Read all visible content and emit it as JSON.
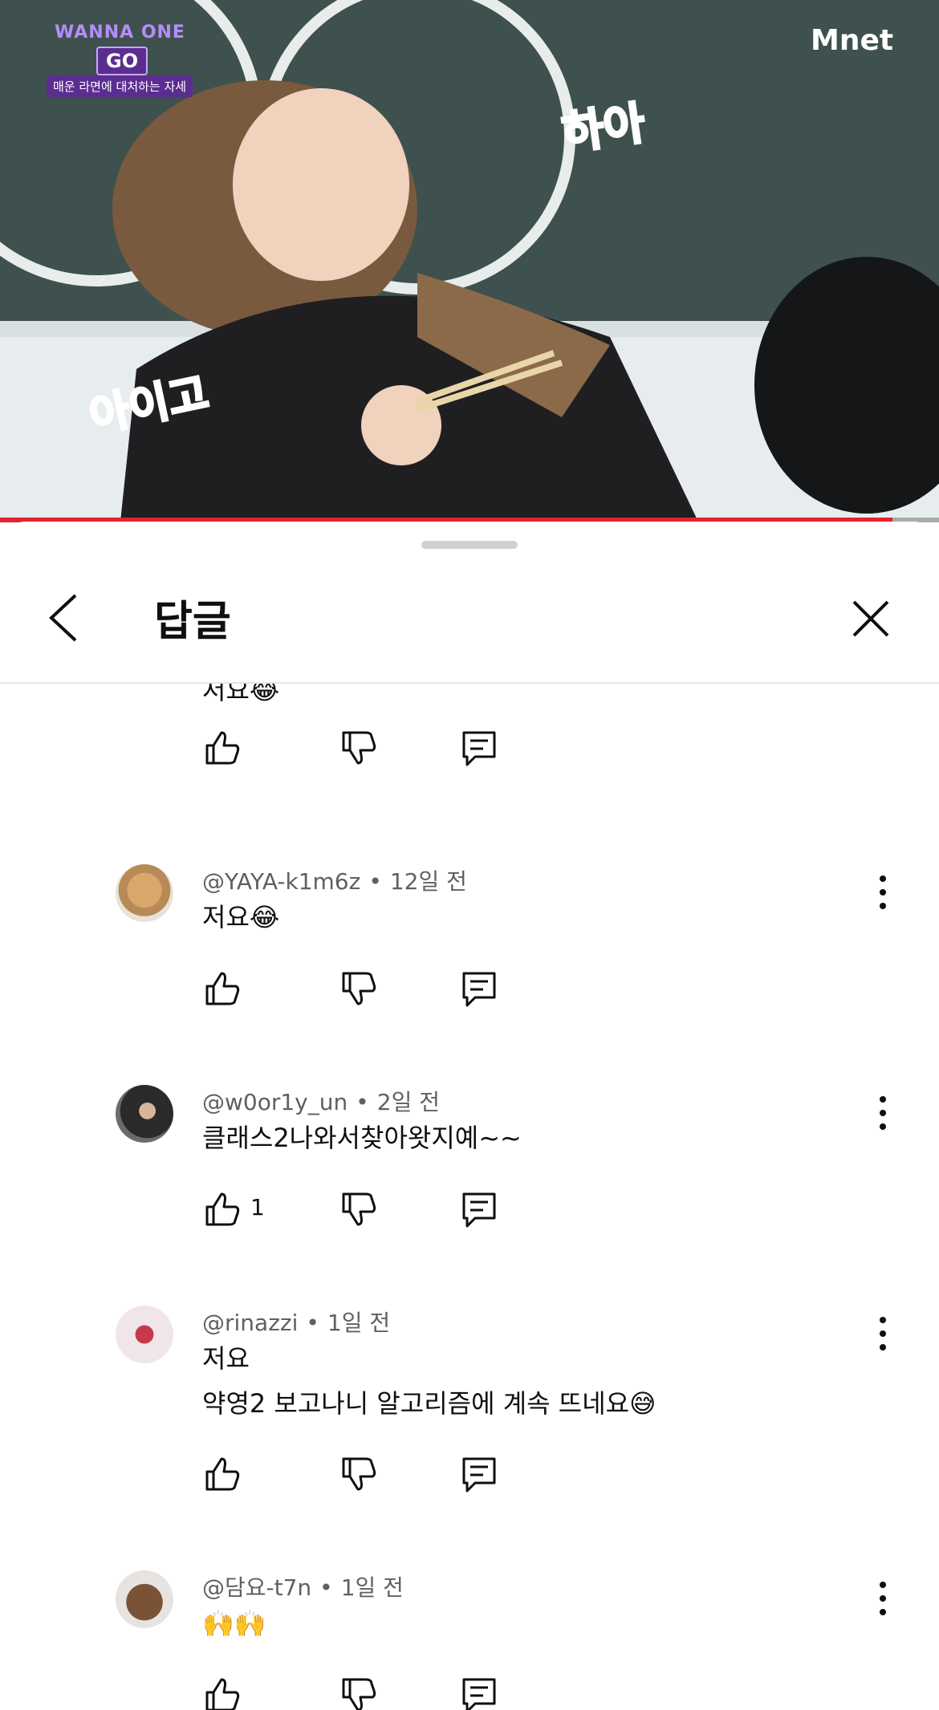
{
  "video": {
    "brand_top": "WANNA ONE",
    "brand_go": "GO",
    "brand_sub": "매운 라면에 대처하는 자세",
    "channel_logo": "Mnet",
    "caption_right": "하아",
    "caption_left": "아이고",
    "progress_fraction": 0.95
  },
  "panel": {
    "title": "답글",
    "back_icon": "chevron-left-icon",
    "close_icon": "close-icon"
  },
  "partial_comment": {
    "text": "저요😂"
  },
  "comments": [
    {
      "author": "@YAYA-k1m6z",
      "time": "12일 전",
      "lines": [
        "저요😂"
      ],
      "likes": ""
    },
    {
      "author": "@w0or1y_un",
      "time": "2일 전",
      "lines": [
        "클래스2나와서찾아왓지예~~"
      ],
      "likes": "1"
    },
    {
      "author": "@rinazzi",
      "time": "1일 전",
      "lines": [
        "저요",
        "약영2 보고나니 알고리즘에 계속 뜨네요😅"
      ],
      "likes": ""
    },
    {
      "author": "@담요-t7n",
      "time": "1일 전",
      "lines": [
        "🙌🙌"
      ],
      "likes": ""
    }
  ],
  "separator": "•",
  "colors": {
    "accent_red": "#e1242d",
    "text": "#0f0f0f",
    "meta": "#606060"
  }
}
